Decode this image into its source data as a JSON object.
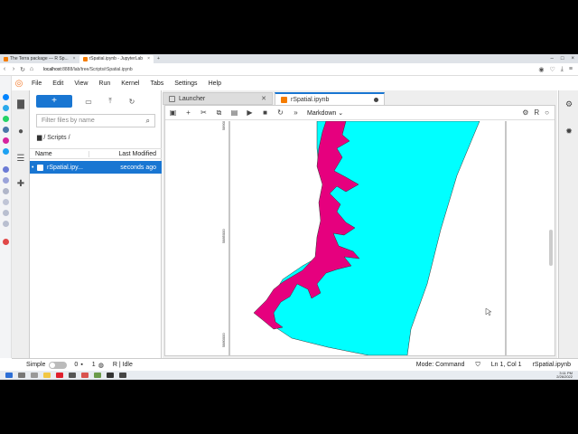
{
  "browser": {
    "tabs": [
      {
        "label": "The Terra package — R Sp...",
        "active": false
      },
      {
        "label": "rSpatial.ipynb - JupyterLab",
        "active": true
      }
    ],
    "url_host": "localhost",
    "url_path": ":8888/lab/tree/Scripts/rSpatial.ipynb"
  },
  "menu": {
    "items": [
      "File",
      "Edit",
      "View",
      "Run",
      "Kernel",
      "Tabs",
      "Settings",
      "Help"
    ]
  },
  "filebrowser": {
    "new_label": "+",
    "filter_placeholder": "Filter files by name",
    "breadcrumb": "/ Scripts /",
    "col_name": "Name",
    "col_modified": "Last Modified",
    "files": [
      {
        "name": "rSpatial.ipy...",
        "modified": "seconds ago",
        "selected": true
      }
    ]
  },
  "dock": {
    "tabs": [
      {
        "label": "Launcher",
        "active": false
      },
      {
        "label": "rSpatial.ipynb",
        "active": true,
        "unsaved": true
      }
    ],
    "cell_type": "Markdown",
    "kernel_label": "R"
  },
  "plot": {
    "land_color": "#e6007e",
    "water_color": "#00ffff",
    "ytick_labels": [
      "5890000",
      "5885000",
      "5880000"
    ]
  },
  "statusbar": {
    "mode_label": "Simple",
    "terminals": "0",
    "kernels": "1",
    "kernel_status": "R | Idle",
    "command_mode": "Mode: Command",
    "cursor": "Ln 1, Col 1",
    "filename": "rSpatial.ipynb"
  },
  "taskbar": {
    "time": "3:11 PM",
    "date": "2/26/2022"
  }
}
